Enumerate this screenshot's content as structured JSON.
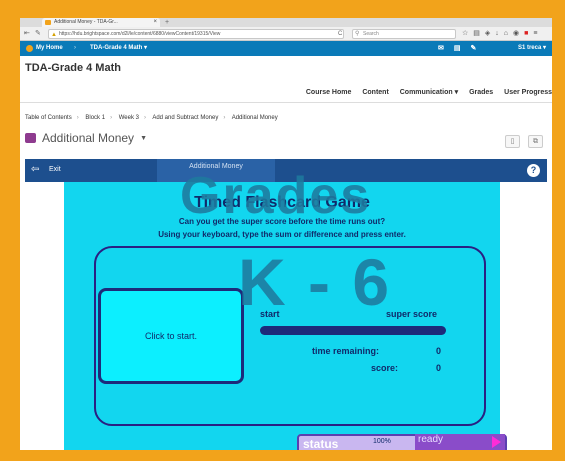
{
  "browser": {
    "tab_title": "Additional Money - TDA-Gr...",
    "tab_close": "×",
    "new_tab": "+",
    "url": "https://hdu.brightspace.com/d2l/le/content/6880/viewContent/19315/View",
    "search_placeholder": "Search",
    "reload_icon": "C",
    "toolbar_icons": [
      "star-icon",
      "reading-list-icon",
      "pocket-icon",
      "download-icon",
      "home-icon",
      "extension-icon",
      "red-extension-icon",
      "menu-icon"
    ]
  },
  "nav": {
    "home_label": "My Home",
    "separator": "›",
    "course_label": "TDA-Grade 4 Math",
    "user_label": "S1 treca"
  },
  "course": {
    "title": "TDA-Grade 4 Math",
    "menu": [
      "Course Home",
      "Content",
      "Communication",
      "Grades",
      "User Progress"
    ]
  },
  "breadcrumb": [
    "Table of Contents",
    "Block 1",
    "Week 3",
    "Add and Subtract Money",
    "Additional Money"
  ],
  "page_title": "Additional Money",
  "content_bar": {
    "exit_label": "Exit",
    "tab_title": "Additional Money",
    "help_label": "?"
  },
  "game": {
    "title": "Timed Flashcard Game",
    "line1": "Can you get the super score before the time runs out?",
    "line2": "Using your keyboard, type the sum or difference and press enter.",
    "start_button": "Click to start.",
    "start_label": "start",
    "super_score_label": "super score",
    "time_remaining_label": "time remaining:",
    "time_remaining_value": "0",
    "score_label": "score:",
    "score_value": "0",
    "status_label": "status",
    "status_percent": "100%",
    "ready_label": "ready"
  },
  "watermark": {
    "line1": "Grades",
    "line2": "K - 6"
  },
  "colors": {
    "border": "#f2a31b",
    "brightspace_nav": "#0a7ab8",
    "content_bar": "#1d4f8e",
    "game_bg": "#12d6ef",
    "watermark": "#1e7a9f"
  }
}
